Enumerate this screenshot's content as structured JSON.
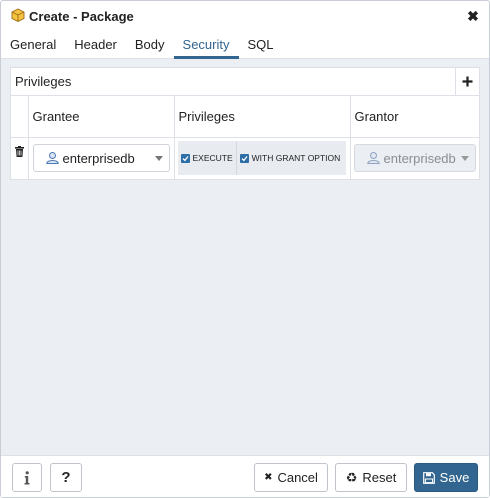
{
  "window": {
    "title": "Create - Package",
    "icon": "package-icon"
  },
  "tabs": [
    {
      "label": "General"
    },
    {
      "label": "Header"
    },
    {
      "label": "Body"
    },
    {
      "label": "Security",
      "active": true
    },
    {
      "label": "SQL"
    }
  ],
  "privileges_panel": {
    "title": "Privileges",
    "columns": {
      "grantee": "Grantee",
      "privileges": "Privileges",
      "grantor": "Grantor"
    },
    "rows": [
      {
        "grantee": "enterprisedb",
        "privileges": [
          {
            "label": "EXECUTE",
            "checked": true
          },
          {
            "label": "WITH GRANT OPTION",
            "checked": true
          }
        ],
        "grantor": "enterprisedb"
      }
    ]
  },
  "footer": {
    "cancel_label": "Cancel",
    "reset_label": "Reset",
    "save_label": "Save",
    "help_label": "?"
  },
  "colors": {
    "accent": "#326690",
    "background": "#ebeef3",
    "checkbox": "#2e6ea6"
  }
}
